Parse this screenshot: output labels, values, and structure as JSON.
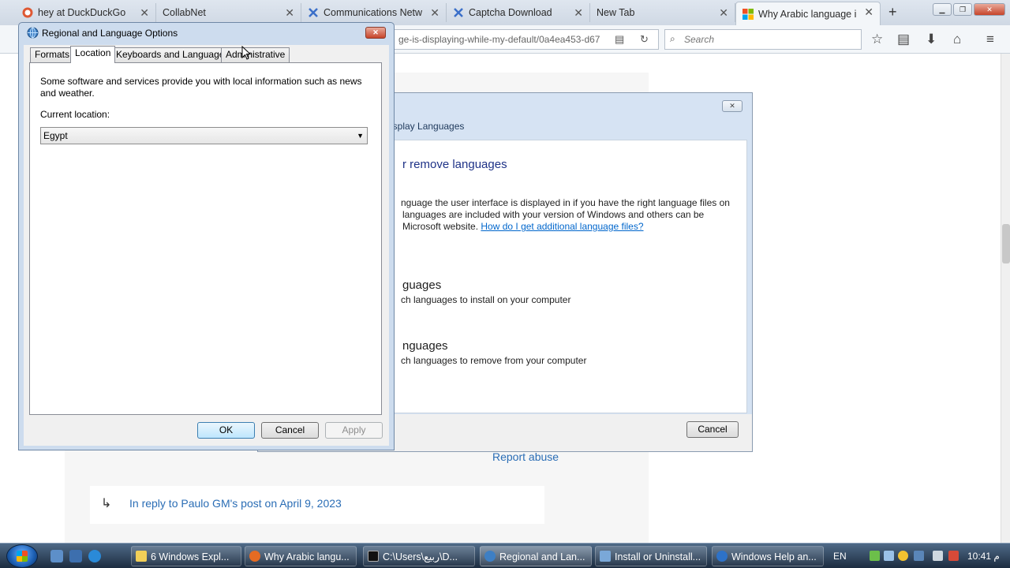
{
  "browser": {
    "tabs": [
      {
        "label": "hey at DuckDuckGo",
        "icon": "duckduckgo-icon"
      },
      {
        "label": "CollabNet",
        "icon": "blank-page-icon"
      },
      {
        "label": "Communications Netw",
        "icon": "x-logo-icon"
      },
      {
        "label": "Captcha Download",
        "icon": "x-logo-icon"
      },
      {
        "label": "New Tab",
        "icon": "blank-page-icon"
      },
      {
        "label": "Why Arabic language is",
        "icon": "windows-logo-icon"
      }
    ],
    "url": "ge-is-displaying-while-my-default/0a4ea453-d67",
    "search_placeholder": "Search"
  },
  "page": {
    "report_abuse": "Report abuse",
    "reply_text": "In reply to Paulo GM's post on April 9, 2023"
  },
  "install_dialog": {
    "header": "isplay Languages",
    "heading": "r remove languages",
    "desc_lines": [
      "nguage the user interface is displayed in if you have the right language files on",
      "languages are included with your version of Windows and others can be",
      "Microsoft website."
    ],
    "link": "How do I get additional language files?",
    "install_title": "guages",
    "install_sub": "ch languages to install on your computer",
    "uninstall_title": "nguages",
    "uninstall_sub": "ch languages to remove from your computer",
    "cancel": "Cancel"
  },
  "regional_dialog": {
    "title": "Regional and Language Options",
    "tabs": [
      "Formats",
      "Location",
      "Keyboards and Languages",
      "Administrative"
    ],
    "active_tab": "Location",
    "description": "Some software and services provide you with local information such as news and weather.",
    "current_location_label": "Current location:",
    "current_location_value": "Egypt",
    "ok": "OK",
    "cancel": "Cancel",
    "apply": "Apply"
  },
  "taskbar": {
    "items": [
      {
        "label": "6 Windows Expl...",
        "icon": "folder-icon"
      },
      {
        "label": "Why Arabic langu...",
        "icon": "firefox-icon"
      },
      {
        "label": "C:\\Users\\ربيع\\D...",
        "icon": "cmd-icon"
      },
      {
        "label": "Regional and Lan...",
        "icon": "globe-icon"
      },
      {
        "label": "Install or Uninstall...",
        "icon": "install-icon"
      },
      {
        "label": "Windows Help an...",
        "icon": "help-icon"
      }
    ],
    "language": "EN",
    "clock": "10:41 م"
  },
  "colors": {
    "link": "#2a6db5",
    "heading_blue": "#1e3287"
  }
}
